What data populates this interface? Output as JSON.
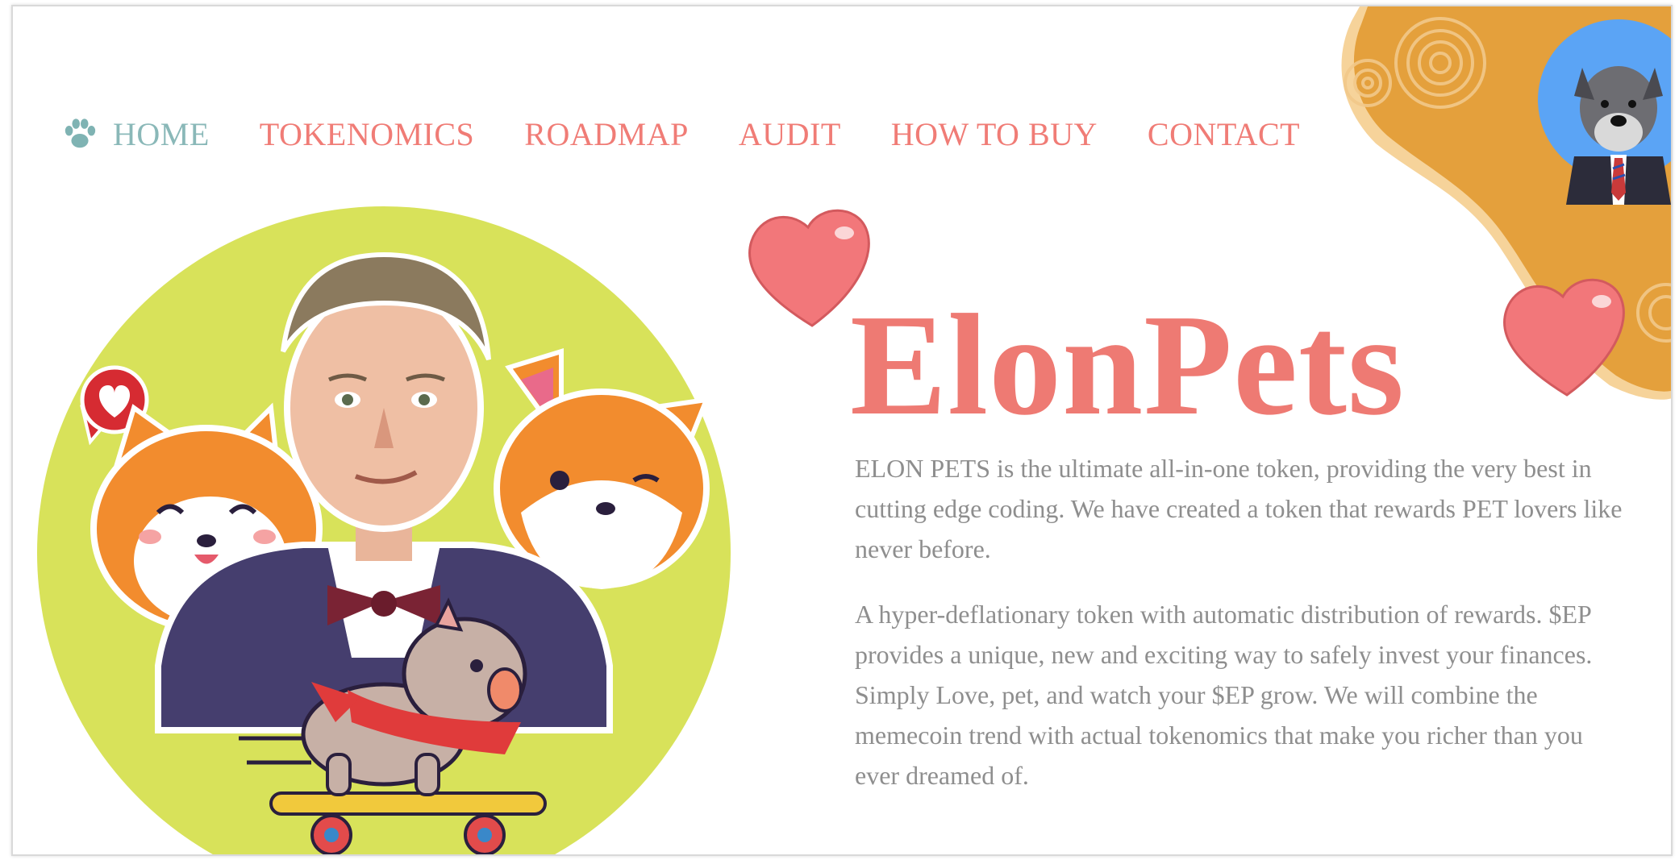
{
  "nav": {
    "home": "HOME",
    "tokenomics": "TOKENOMICS",
    "roadmap": "ROADMAP",
    "audit": "AUDIT",
    "how_to_buy": "HOW TO BUY",
    "contact": "CONTACT"
  },
  "hero": {
    "title": "ElonPets",
    "paragraph_1": "ELON PETS is the ultimate all-in-one token, providing the very best in cutting edge coding. We have created a token that rewards PET lovers like never before.",
    "paragraph_2": "A hyper-deflationary token with automatic distribution of rewards. $EP provides a unique, new and exciting way to safely invest your finances. Simply Love, pet, and watch your $EP grow. We will combine the memecoin trend with actual tokenomics that make you richer than you ever dreamed of."
  },
  "icons": {
    "nav_home": "paw-icon",
    "heart_left": "heart-icon",
    "heart_right": "heart-icon",
    "speech_heart": "heart-speech-bubble-icon"
  },
  "colors": {
    "accent": "#ee7a73",
    "home_link": "#8ab8b8",
    "text": "#8e8e8e",
    "hero_circle": "#d8e25a",
    "corner_blob": "#e4a03c",
    "avatar_bg": "#5ba4f5"
  }
}
